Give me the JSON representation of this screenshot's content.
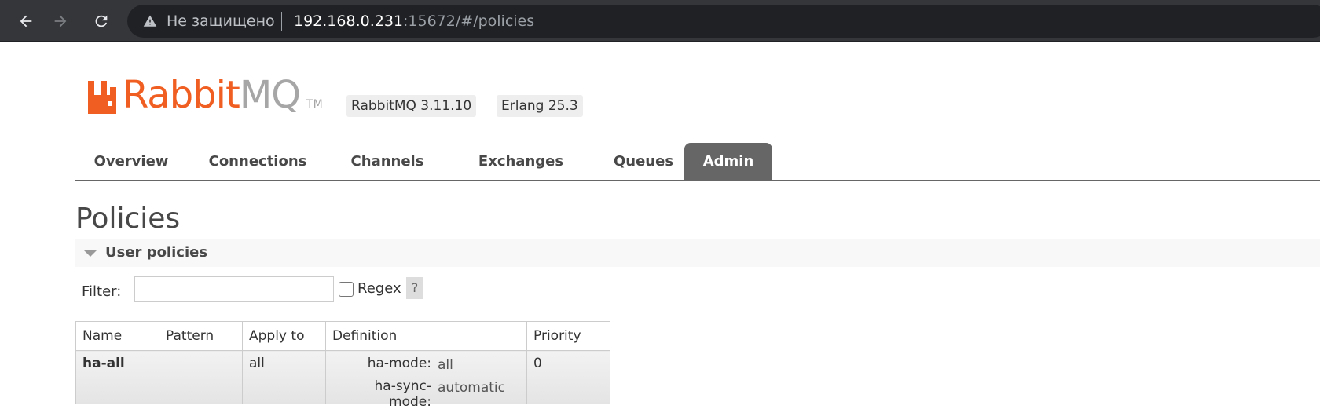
{
  "browser": {
    "security_label": "Не защищено",
    "url_host": "192.168.0.231",
    "url_rest": ":15672/#/policies"
  },
  "header": {
    "logo_rabbit": "Rabbit",
    "logo_mq": "MQ",
    "logo_tm": "TM",
    "rabbitmq_version": "RabbitMQ 3.11.10",
    "erlang_version": "Erlang 25.3"
  },
  "tabs": [
    {
      "label": "Overview",
      "active": false
    },
    {
      "label": "Connections",
      "active": false
    },
    {
      "label": "Channels",
      "active": false
    },
    {
      "label": "Exchanges",
      "active": false
    },
    {
      "label": "Queues",
      "active": false
    },
    {
      "label": "Admin",
      "active": true
    }
  ],
  "page": {
    "title": "Policies",
    "section_title": "User policies"
  },
  "filter": {
    "label": "Filter:",
    "value": "",
    "regex_label": "Regex",
    "regex_checked": false,
    "help_label": "?"
  },
  "table": {
    "columns": [
      "Name",
      "Pattern",
      "Apply to",
      "Definition",
      "Priority"
    ],
    "rows": [
      {
        "name": "ha-all",
        "pattern": "",
        "apply_to": "all",
        "definition": [
          {
            "key": "ha-mode:",
            "value": "all"
          },
          {
            "key": "ha-sync-mode:",
            "value": "automatic"
          }
        ],
        "priority": "0"
      }
    ]
  },
  "colors": {
    "brand_orange": "#f05f21",
    "brand_gray": "#a6a6a6",
    "active_tab": "#666666"
  }
}
